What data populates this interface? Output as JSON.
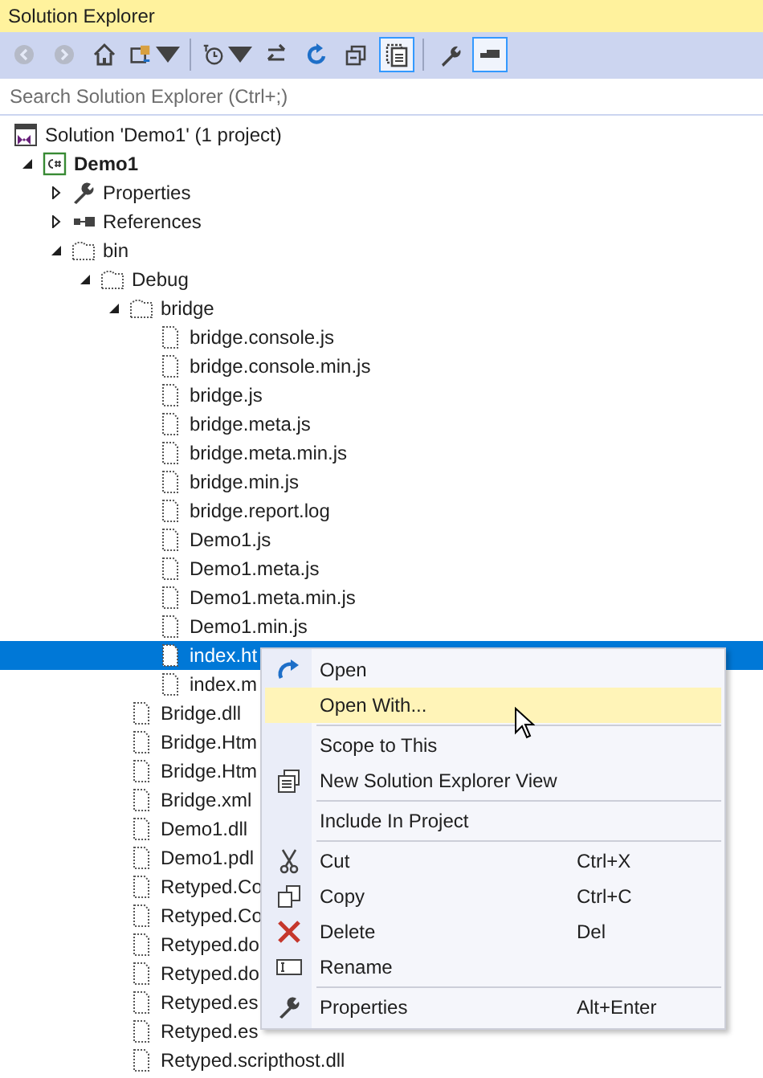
{
  "window": {
    "title": "Solution Explorer"
  },
  "toolbar": {
    "buttons": [
      {
        "kind": "back",
        "disabled": true,
        "pressed": false,
        "dropdown": false
      },
      {
        "kind": "forward",
        "disabled": true,
        "pressed": false,
        "dropdown": false
      },
      {
        "kind": "home",
        "disabled": false,
        "pressed": false,
        "dropdown": false
      },
      {
        "kind": "switch-views",
        "disabled": false,
        "pressed": false,
        "dropdown": true
      },
      {
        "kind": "separator"
      },
      {
        "kind": "pending-filter",
        "disabled": false,
        "pressed": false,
        "dropdown": true
      },
      {
        "kind": "sync",
        "disabled": false,
        "pressed": false,
        "dropdown": false
      },
      {
        "kind": "refresh",
        "disabled": false,
        "pressed": false,
        "dropdown": false
      },
      {
        "kind": "collapse-all",
        "disabled": false,
        "pressed": false,
        "dropdown": false
      },
      {
        "kind": "show-all-files",
        "disabled": false,
        "pressed": true,
        "dropdown": false
      },
      {
        "kind": "separator"
      },
      {
        "kind": "properties",
        "disabled": false,
        "pressed": false,
        "dropdown": false
      },
      {
        "kind": "preview",
        "disabled": false,
        "pressed": true,
        "dropdown": false
      }
    ]
  },
  "search": {
    "placeholder": "Search Solution Explorer (Ctrl+;)"
  },
  "tree": [
    {
      "label": "Solution 'Demo1' (1 project)",
      "kind": "solution",
      "selected": false,
      "children": [
        {
          "label": "Demo1",
          "kind": "project",
          "expanded": true,
          "selected": false,
          "children": [
            {
              "label": "Properties",
              "kind": "wrench",
              "expanded": false,
              "selected": false
            },
            {
              "label": "References",
              "kind": "references",
              "expanded": false,
              "selected": false
            },
            {
              "label": "bin",
              "kind": "folder",
              "expanded": true,
              "selected": false,
              "children": [
                {
                  "label": "Debug",
                  "kind": "folder",
                  "expanded": true,
                  "selected": false,
                  "children": [
                    {
                      "label": "bridge",
                      "kind": "folder",
                      "expanded": true,
                      "selected": false,
                      "children": [
                        {
                          "label": "bridge.console.js",
                          "kind": "file",
                          "selected": false
                        },
                        {
                          "label": "bridge.console.min.js",
                          "kind": "file",
                          "selected": false
                        },
                        {
                          "label": "bridge.js",
                          "kind": "file",
                          "selected": false
                        },
                        {
                          "label": "bridge.meta.js",
                          "kind": "file",
                          "selected": false
                        },
                        {
                          "label": "bridge.meta.min.js",
                          "kind": "file",
                          "selected": false
                        },
                        {
                          "label": "bridge.min.js",
                          "kind": "file",
                          "selected": false
                        },
                        {
                          "label": "bridge.report.log",
                          "kind": "file",
                          "selected": false
                        },
                        {
                          "label": "Demo1.js",
                          "kind": "file",
                          "selected": false
                        },
                        {
                          "label": "Demo1.meta.js",
                          "kind": "file",
                          "selected": false
                        },
                        {
                          "label": "Demo1.meta.min.js",
                          "kind": "file",
                          "selected": false
                        },
                        {
                          "label": "Demo1.min.js",
                          "kind": "file",
                          "selected": false
                        },
                        {
                          "label": "index.ht",
                          "kind": "file",
                          "selected": true
                        },
                        {
                          "label": "index.m",
                          "kind": "file",
                          "selected": false
                        }
                      ]
                    },
                    {
                      "label": "Bridge.dll",
                      "kind": "file",
                      "selected": false
                    },
                    {
                      "label": "Bridge.Htm",
                      "kind": "file",
                      "selected": false
                    },
                    {
                      "label": "Bridge.Htm",
                      "kind": "file",
                      "selected": false
                    },
                    {
                      "label": "Bridge.xml",
                      "kind": "file",
                      "selected": false
                    },
                    {
                      "label": "Demo1.dll",
                      "kind": "file",
                      "selected": false
                    },
                    {
                      "label": "Demo1.pdl",
                      "kind": "file",
                      "selected": false
                    },
                    {
                      "label": "Retyped.Co",
                      "kind": "file",
                      "selected": false
                    },
                    {
                      "label": "Retyped.Co",
                      "kind": "file",
                      "selected": false
                    },
                    {
                      "label": "Retyped.do",
                      "kind": "file",
                      "selected": false
                    },
                    {
                      "label": "Retyped.do",
                      "kind": "file",
                      "selected": false
                    },
                    {
                      "label": "Retyped.es",
                      "kind": "file",
                      "selected": false
                    },
                    {
                      "label": "Retyped.es",
                      "kind": "file",
                      "selected": false
                    },
                    {
                      "label": "Retyped.scripthost.dll",
                      "kind": "file",
                      "selected": false
                    }
                  ]
                }
              ]
            }
          ]
        }
      ]
    }
  ],
  "context_menu": {
    "items": [
      {
        "kind": "open",
        "label": "Open",
        "selected": false
      },
      {
        "kind": "plain",
        "label": "Open With...",
        "selected": true
      },
      {
        "kind": "separator"
      },
      {
        "kind": "plain",
        "label": "Scope to This",
        "selected": false
      },
      {
        "kind": "new-view",
        "label": "New Solution Explorer View",
        "selected": false
      },
      {
        "kind": "separator"
      },
      {
        "kind": "plain",
        "label": "Include In Project",
        "selected": false
      },
      {
        "kind": "separator"
      },
      {
        "kind": "cut",
        "label": "Cut",
        "shortcut": "Ctrl+X",
        "selected": false
      },
      {
        "kind": "copy",
        "label": "Copy",
        "shortcut": "Ctrl+C",
        "selected": false
      },
      {
        "kind": "delete",
        "label": "Delete",
        "shortcut": "Del",
        "selected": false
      },
      {
        "kind": "rename",
        "label": "Rename",
        "selected": false
      },
      {
        "kind": "separator"
      },
      {
        "kind": "wrench",
        "label": "Properties",
        "shortcut": "Alt+Enter",
        "selected": false
      }
    ]
  }
}
